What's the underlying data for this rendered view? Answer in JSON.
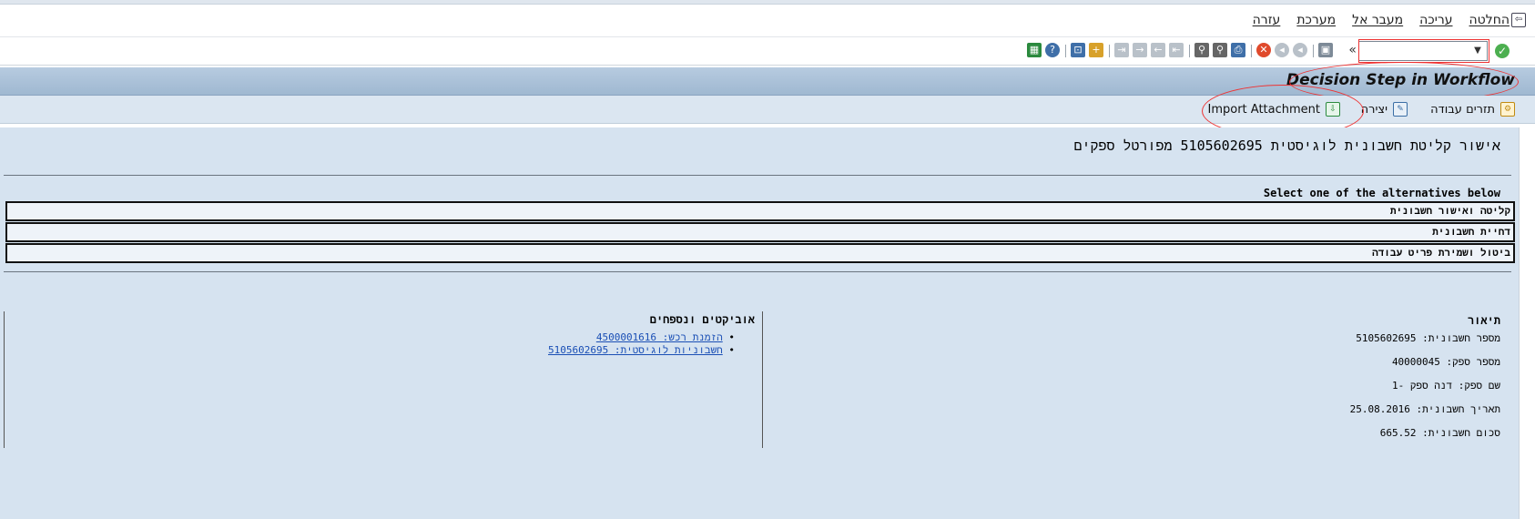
{
  "menu": {
    "items": [
      "החלטה",
      "עריכה",
      "מעבר אל",
      "מערכת",
      "עזרה"
    ]
  },
  "toolbar": {
    "command_value": "",
    "icons": [
      "ok-icon",
      "save-icon",
      "back-icon",
      "exit-icon",
      "cancel-icon",
      "print-icon",
      "find-icon",
      "find-next-icon",
      "first-page-icon",
      "previous-page-icon",
      "next-page-icon",
      "last-page-icon",
      "new-session-icon",
      "shortcut-icon",
      "help-icon",
      "layout-icon"
    ]
  },
  "title": "Decision Step in Workflow",
  "app_toolbar": {
    "services_label": "תזרים עבודה",
    "create_label": "יצירה",
    "import_label": "Import Attachment"
  },
  "main": {
    "heading": "אישור קליטת חשבונית לוגיסטית 5105602695 מפורטל ספקים",
    "prompt": "Select one of the alternatives below",
    "alternatives": [
      "קליטה ואישור חשבונית",
      "דחיית חשבונית",
      "ביטול ושמירת פריט עבודה"
    ],
    "description_header": "תיאור",
    "fields": [
      "מספר חשבונית: 5105602695",
      "מספר ספק: 40000045",
      "שם ספק: דנה ספק -1",
      "תאריך חשבונית: 25.08.2016",
      "סכום חשבונית: 665.52"
    ],
    "objects_header": "אוביקטים ונספחים",
    "objects": [
      "הזמנת רכש: 4500001616",
      "חשבוניות לוגיסטית: 5105602695"
    ]
  },
  "colors": {
    "title_bar": "#9fb8d1",
    "main_bg": "#d6e3f0",
    "link": "#1a4fb5",
    "annotation": "#e33333"
  }
}
